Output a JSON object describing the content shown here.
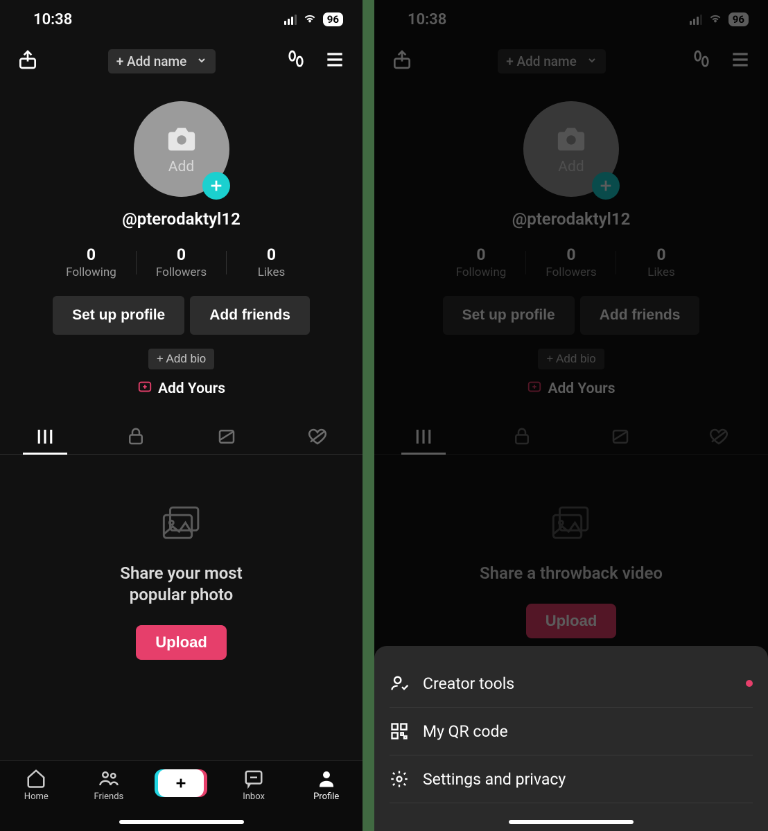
{
  "status": {
    "time": "10:38",
    "battery": "96"
  },
  "header": {
    "add_name": "+ Add name"
  },
  "avatar": {
    "add": "Add",
    "username": "@pterodaktyl12"
  },
  "stats": {
    "following": {
      "value": "0",
      "label": "Following"
    },
    "followers": {
      "value": "0",
      "label": "Followers"
    },
    "likes": {
      "value": "0",
      "label": "Likes"
    }
  },
  "actions": {
    "setup": "Set up profile",
    "add_friends": "Add friends"
  },
  "bio": {
    "add_bio": "+ Add bio",
    "add_yours": "Add Yours"
  },
  "left_prompt": {
    "line1": "Share your most",
    "line2": "popular photo",
    "upload": "Upload"
  },
  "right_prompt": {
    "line1": "Share a throwback video",
    "upload": "Upload"
  },
  "tabbar": {
    "home": "Home",
    "friends": "Friends",
    "inbox": "Inbox",
    "profile": "Profile"
  },
  "sheet": {
    "creator_tools": "Creator tools",
    "qr": "My QR code",
    "settings": "Settings and privacy"
  }
}
